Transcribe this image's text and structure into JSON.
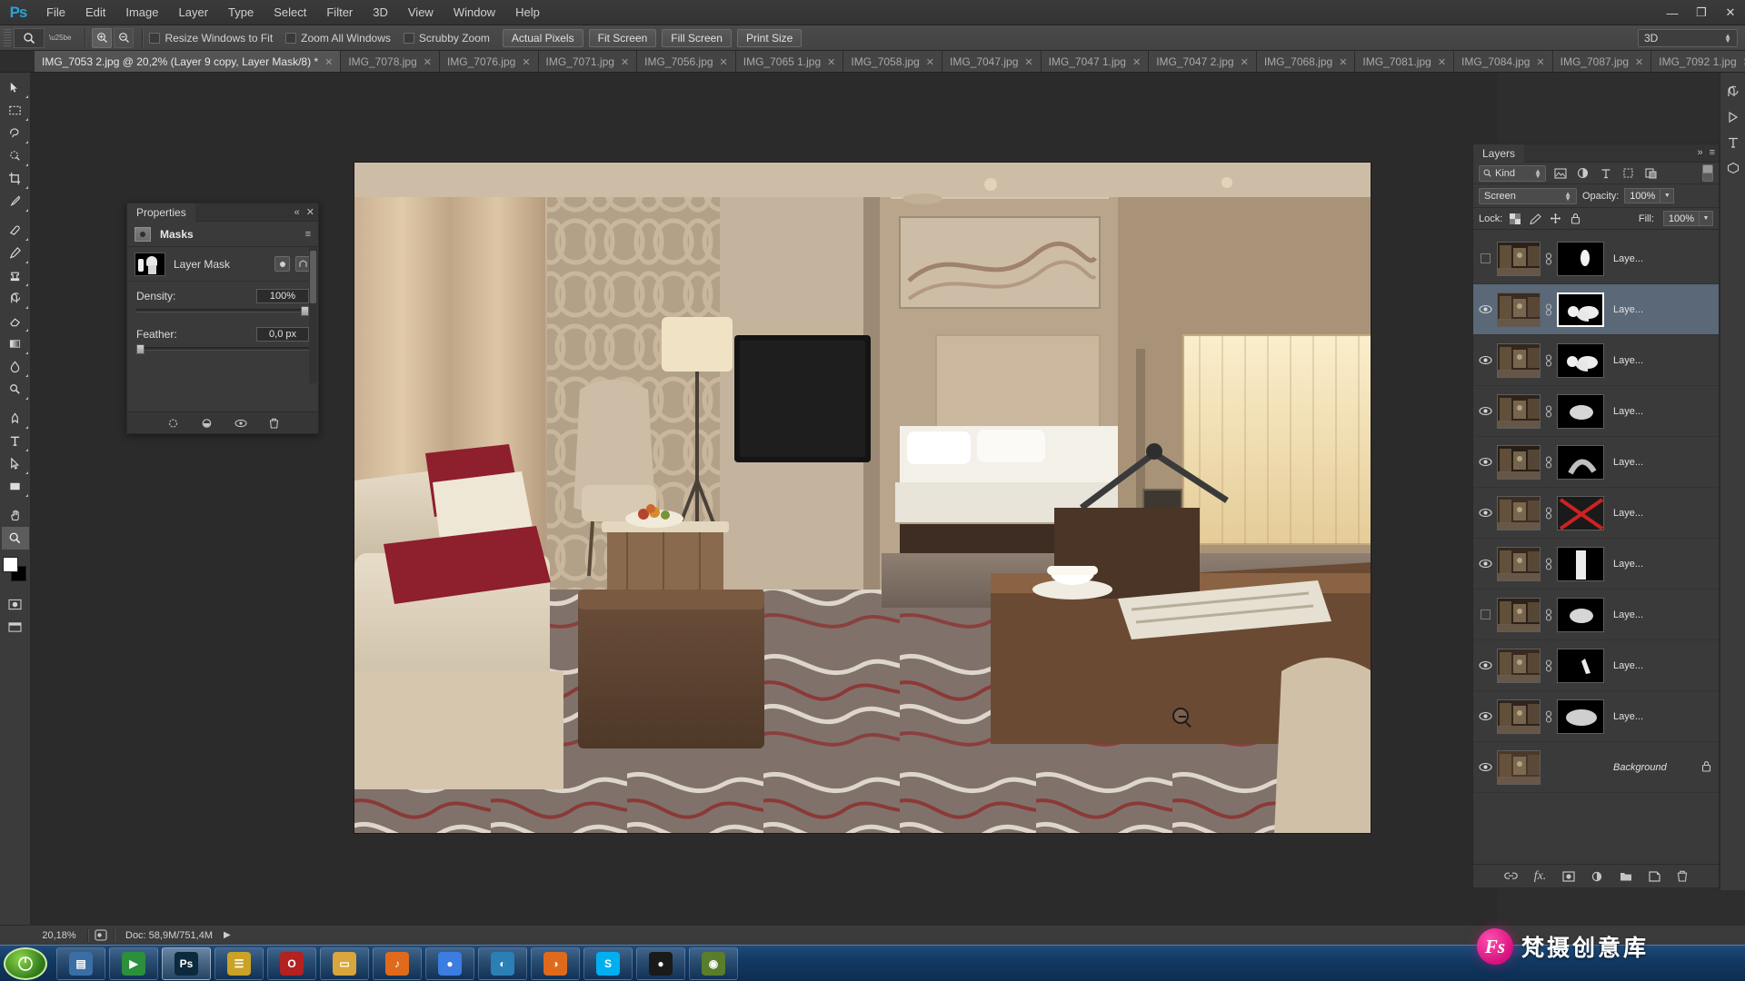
{
  "app": {
    "name": "Adobe Photoshop",
    "logo": "Ps"
  },
  "menubar": {
    "items": [
      "File",
      "Edit",
      "Image",
      "Layer",
      "Type",
      "Select",
      "Filter",
      "3D",
      "View",
      "Window",
      "Help"
    ],
    "window_controls": [
      "minimize",
      "restore",
      "close"
    ],
    "min_glyph": "—",
    "restore_glyph": "❐",
    "close_glyph": "✕"
  },
  "options_bar": {
    "tool": "zoom-tool",
    "zoom_in_label": "⊕",
    "zoom_out_label": "⊖",
    "checkboxes": [
      {
        "label": "Resize Windows to Fit",
        "checked": false
      },
      {
        "label": "Zoom All Windows",
        "checked": false
      },
      {
        "label": "Scrubby Zoom",
        "checked": false
      }
    ],
    "buttons": [
      "Actual Pixels",
      "Fit Screen",
      "Fill Screen",
      "Print Size"
    ],
    "workspace": "3D"
  },
  "tabs": {
    "items": [
      {
        "label": "IMG_7053 2.jpg @ 20,2% (Layer 9 copy, Layer Mask/8) *",
        "active": true
      },
      {
        "label": "IMG_7078.jpg",
        "active": false
      },
      {
        "label": "IMG_7076.jpg",
        "active": false
      },
      {
        "label": "IMG_7071.jpg",
        "active": false
      },
      {
        "label": "IMG_7056.jpg",
        "active": false
      },
      {
        "label": "IMG_7065 1.jpg",
        "active": false
      },
      {
        "label": "IMG_7058.jpg",
        "active": false
      },
      {
        "label": "IMG_7047.jpg",
        "active": false
      },
      {
        "label": "IMG_7047 1.jpg",
        "active": false
      },
      {
        "label": "IMG_7047 2.jpg",
        "active": false
      },
      {
        "label": "IMG_7068.jpg",
        "active": false
      },
      {
        "label": "IMG_7081.jpg",
        "active": false
      },
      {
        "label": "IMG_7084.jpg",
        "active": false
      },
      {
        "label": "IMG_7087.jpg",
        "active": false
      },
      {
        "label": "IMG_7092 1.jpg",
        "active": false
      }
    ],
    "close_glyph": "✕",
    "overflow_glyph": "»"
  },
  "toolbar": {
    "tools": [
      "move-tool",
      "marquee-tool",
      "lasso-tool",
      "quick-selection-tool",
      "crop-tool",
      "eyedropper-tool",
      "spot-healing-tool",
      "brush-tool",
      "clone-stamp-tool",
      "history-brush-tool",
      "eraser-tool",
      "gradient-tool",
      "blur-tool",
      "dodge-tool",
      "pen-tool",
      "type-tool",
      "path-selection-tool",
      "rectangle-tool",
      "hand-tool",
      "zoom-tool"
    ],
    "selected": "zoom-tool",
    "foreground_color": "#ffffff",
    "background_color": "#000000"
  },
  "properties_panel": {
    "tab_label": "Properties",
    "title": "Masks",
    "mask_type": "Layer Mask",
    "density": {
      "label": "Density:",
      "value": "100%",
      "percent": 100
    },
    "feather": {
      "label": "Feather:",
      "value": "0,0 px",
      "percent": 0
    },
    "footer_icons": [
      "load-selection-icon",
      "apply-mask-icon",
      "disable-mask-icon",
      "delete-mask-icon"
    ],
    "collapse_glyph": "«",
    "close_glyph": "✕",
    "menu_glyph": "≡"
  },
  "layers_panel": {
    "tab_label": "Layers",
    "filter": {
      "kind_label": "Kind",
      "search_icon": "search-icon"
    },
    "filter_icons": [
      "pixel-filter-icon",
      "adjustment-filter-icon",
      "type-filter-icon",
      "shape-filter-icon",
      "smart-object-filter-icon"
    ],
    "blend_mode": "Screen",
    "opacity": {
      "label": "Opacity:",
      "value": "100%"
    },
    "fill": {
      "label": "Fill:",
      "value": "100%"
    },
    "lock": {
      "label": "Lock:",
      "icons": [
        "lock-transparent-icon",
        "lock-image-icon",
        "lock-position-icon",
        "lock-all-icon"
      ]
    },
    "rows": [
      {
        "name": "Laye...",
        "visible": false,
        "selected": false,
        "linked": true,
        "mask": "small-blob",
        "locked": false
      },
      {
        "name": "Laye...",
        "visible": true,
        "selected": true,
        "linked": true,
        "mask": "two-blobs",
        "locked": false
      },
      {
        "name": "Laye...",
        "visible": true,
        "selected": false,
        "linked": true,
        "mask": "two-blobs",
        "locked": false
      },
      {
        "name": "Laye...",
        "visible": true,
        "selected": false,
        "linked": true,
        "mask": "soft-blob",
        "locked": false
      },
      {
        "name": "Laye...",
        "visible": true,
        "selected": false,
        "linked": true,
        "mask": "arc-blob",
        "locked": false
      },
      {
        "name": "Laye...",
        "visible": true,
        "selected": false,
        "linked": true,
        "mask": "disabled-red-x",
        "locked": false
      },
      {
        "name": "Laye...",
        "visible": true,
        "selected": false,
        "linked": true,
        "mask": "vertical-bar",
        "locked": false
      },
      {
        "name": "Laye...",
        "visible": false,
        "selected": false,
        "linked": true,
        "mask": "soft-blob",
        "locked": false
      },
      {
        "name": "Laye...",
        "visible": true,
        "selected": false,
        "linked": true,
        "mask": "streak-blob",
        "locked": false
      },
      {
        "name": "Laye...",
        "visible": true,
        "selected": false,
        "linked": true,
        "mask": "wide-blob",
        "locked": false
      },
      {
        "name": "Background",
        "visible": true,
        "selected": false,
        "linked": false,
        "mask": null,
        "locked": true
      }
    ],
    "footer_icons": [
      "link-layers-icon",
      "layer-style-icon",
      "layer-mask-icon",
      "adjustment-layer-icon",
      "new-group-icon",
      "new-layer-icon",
      "delete-layer-icon"
    ],
    "lock_glyph": "🔒",
    "link_glyph": "⚭",
    "eye_glyph": "◉",
    "collapse_glyph": "»",
    "menu_glyph": "≡"
  },
  "status_bar": {
    "zoom": "20,18%",
    "doc_info": "Doc: 58,9M/751,4M",
    "arrow_glyph": "▶",
    "grid_icon": "proof-colors-icon"
  },
  "taskbar": {
    "start_label": "start",
    "items": [
      {
        "name": "window-switcher",
        "label": "▤",
        "color": "#3a6ea5",
        "active": false
      },
      {
        "name": "media-player",
        "label": "▶",
        "color": "#2c8f3c",
        "active": false
      },
      {
        "name": "photoshop",
        "label": "Ps",
        "color": "#0b2a3d",
        "active": true
      },
      {
        "name": "explorer",
        "label": "☰",
        "color": "#c9a227",
        "active": false
      },
      {
        "name": "opera",
        "label": "O",
        "color": "#b32121",
        "active": false
      },
      {
        "name": "folder",
        "label": "▭",
        "color": "#d8a63b",
        "active": false
      },
      {
        "name": "music-app",
        "label": "♪",
        "color": "#e06a1b",
        "active": false
      },
      {
        "name": "chrome",
        "label": "●",
        "color": "#3b7de0",
        "active": false
      },
      {
        "name": "browser-blue",
        "label": "◐",
        "color": "#2a7fb5",
        "active": false
      },
      {
        "name": "firefox",
        "label": "◑",
        "color": "#e06a1b",
        "active": false
      },
      {
        "name": "skype",
        "label": "S",
        "color": "#00aff0",
        "active": false
      },
      {
        "name": "dark-app",
        "label": "●",
        "color": "#1a1a1a",
        "active": false
      },
      {
        "name": "eye-app",
        "label": "◉",
        "color": "#5a7d2b",
        "active": false
      }
    ]
  },
  "watermark": {
    "logo": "Fs",
    "text": "梵摄创意库"
  },
  "canvas": {
    "document": "IMG_7053 2.jpg",
    "zoom_percent": "20,2%",
    "scene": "hotel-room-interior-photo"
  }
}
